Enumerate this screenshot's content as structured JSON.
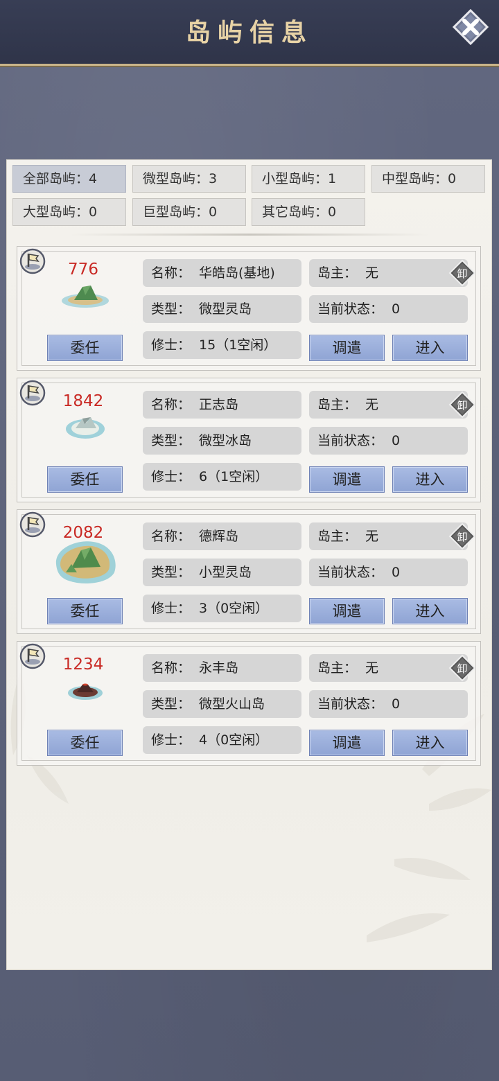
{
  "header": {
    "title": "岛屿信息"
  },
  "filters": [
    {
      "label": "全部岛屿：",
      "count": "4"
    },
    {
      "label": "微型岛屿：",
      "count": "3"
    },
    {
      "label": "小型岛屿：",
      "count": "1"
    },
    {
      "label": "中型岛屿：",
      "count": "0"
    },
    {
      "label": "大型岛屿：",
      "count": "0"
    },
    {
      "label": "巨型岛屿：",
      "count": "0"
    },
    {
      "label": "其它岛屿：",
      "count": "0"
    }
  ],
  "islands": [
    {
      "power": "776",
      "name": "华皓岛(基地)",
      "owner": "无",
      "type": "微型灵岛",
      "status": "0",
      "cultivators": "15（1空闲）",
      "image": "island-small-green"
    },
    {
      "power": "1842",
      "name": "正志岛",
      "owner": "无",
      "type": "微型冰岛",
      "status": "0",
      "cultivators": "6（1空闲）",
      "image": "island-small-ice"
    },
    {
      "power": "2082",
      "name": "德辉岛",
      "owner": "无",
      "type": "小型灵岛",
      "status": "0",
      "cultivators": "3（0空闲）",
      "image": "island-large-green"
    },
    {
      "power": "1234",
      "name": "永丰岛",
      "owner": "无",
      "type": "微型火山岛",
      "status": "0",
      "cultivators": "4（0空闲）",
      "image": "island-small-volcano"
    }
  ],
  "labels": {
    "name": "名称：",
    "owner": "岛主：",
    "type": "类型：",
    "status": "当前状态：",
    "cultivators": "修士：",
    "appoint_button": "委任",
    "dispatch_button": "调遣",
    "enter_button": "进入",
    "seal_glyph": "卸"
  },
  "colors": {
    "power": "#c92a25",
    "button": "#97abd9",
    "title": "#e8d3a6"
  }
}
